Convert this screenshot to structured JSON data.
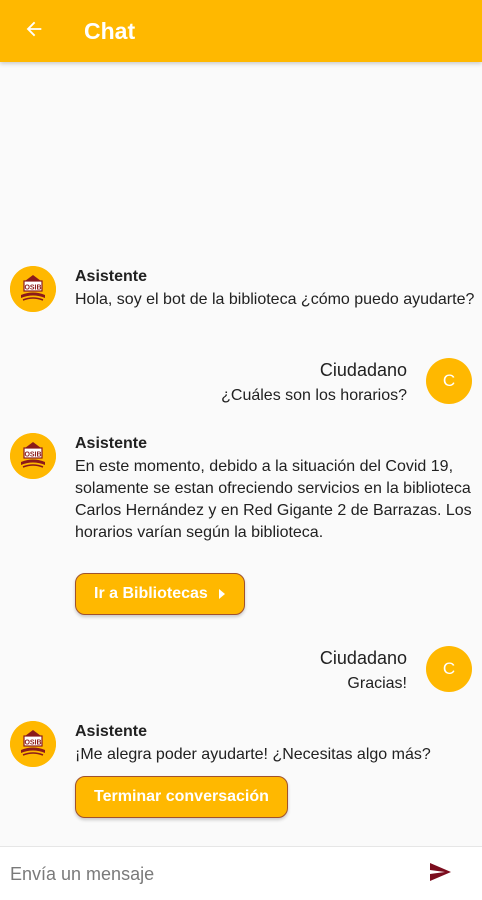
{
  "appbar": {
    "title": "Chat",
    "back_icon": "arrow-left-icon"
  },
  "colors": {
    "accent": "#ffb800",
    "send": "#7b0d1e",
    "button_border": "#a0522d",
    "text": "#212121"
  },
  "bot": {
    "name": "Asistente",
    "logo_text": "OSIB",
    "messages": [
      {
        "text": "Hola, soy el bot de la biblioteca ¿cómo puedo ayudarte?"
      },
      {
        "text": "En este momento, debido a la situación del Covid 19, solamente se estan ofreciendo servicios en la biblioteca Carlos Hernández y en Red Gigante 2 de Barrazas. Los horarios varían según la biblioteca.",
        "button": "Ir a Bibliotecas"
      },
      {
        "text": "¡Me alegra poder ayudarte! ¿Necesitas algo más?",
        "button": "Terminar conversación"
      }
    ]
  },
  "user": {
    "name": "Ciudadano",
    "avatar_letter": "C",
    "messages": [
      {
        "text": "¿Cuáles son los horarios?"
      },
      {
        "text": "Gracias!"
      }
    ]
  },
  "composer": {
    "placeholder": "Envía un mensaje",
    "value": "",
    "send_icon": "send-icon"
  }
}
